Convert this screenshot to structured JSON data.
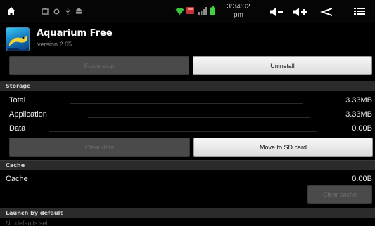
{
  "status_bar": {
    "time": "3:34:02 pm",
    "icons_left": [
      "home-icon",
      "screenshot-icon",
      "circle-icon",
      "usb-icon",
      "android-icon"
    ],
    "icons_right": [
      "wifi-icon",
      "battery-warning-icon",
      "signal-icon",
      "battery-icon"
    ],
    "nav_buttons": [
      "volume-down-icon",
      "volume-up-icon",
      "back-icon",
      "menu-icon"
    ]
  },
  "app": {
    "name": "Aquarium Free",
    "version": "version 2.65"
  },
  "buttons": {
    "force_stop": "Force stop",
    "uninstall": "Uninstall",
    "clear_data": "Clear data",
    "move_to_sd": "Move to SD card",
    "clear_cache": "Clear cache"
  },
  "storage": {
    "header": "Storage",
    "rows": [
      {
        "label": "Total",
        "value": "3.33MB"
      },
      {
        "label": "Application",
        "value": "3.33MB"
      },
      {
        "label": "Data",
        "value": "0.00B"
      }
    ]
  },
  "cache": {
    "header": "Cache",
    "row": {
      "label": "Cache",
      "value": "0.00B"
    }
  },
  "launch": {
    "header": "Launch by default",
    "text": "No defaults set."
  },
  "colors": {
    "background": "#000000",
    "section_header": "#2b2b2b",
    "button_enabled": "#eeeeee",
    "button_disabled": "#4a4a4a",
    "battery_warning": "#d33a3a",
    "battery": "#3fd43f"
  }
}
